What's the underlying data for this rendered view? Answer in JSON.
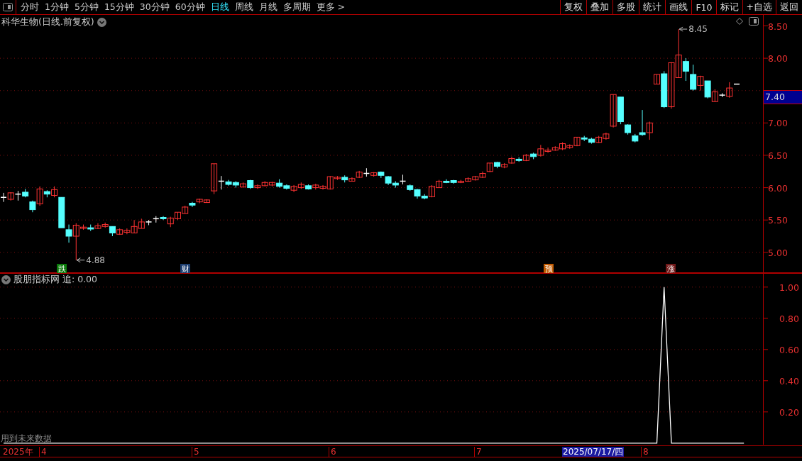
{
  "toolbar": {
    "periods": [
      {
        "label": "分时",
        "selected": false
      },
      {
        "label": "1分钟",
        "selected": false
      },
      {
        "label": "5分钟",
        "selected": false
      },
      {
        "label": "15分钟",
        "selected": false
      },
      {
        "label": "30分钟",
        "selected": false
      },
      {
        "label": "60分钟",
        "selected": false
      },
      {
        "label": "日线",
        "selected": true
      },
      {
        "label": "周线",
        "selected": false
      },
      {
        "label": "月线",
        "selected": false
      },
      {
        "label": "多周期",
        "selected": false
      },
      {
        "label": "更多 >",
        "selected": false
      }
    ],
    "actions": [
      "复权",
      "叠加",
      "多股",
      "统计",
      "画线",
      "F10",
      "标记",
      "+自选",
      "返回"
    ]
  },
  "chart": {
    "title": "科华生物(日线.前复权)",
    "current_price": "7.40",
    "low_label": "4.88",
    "high_label": "8.45",
    "chart_data": {
      "type": "candlestick",
      "ohlc": [
        [
          5.85,
          5.92,
          5.78,
          5.85
        ],
        [
          5.82,
          5.93,
          5.8,
          5.92
        ],
        [
          5.9,
          5.95,
          5.8,
          5.9
        ],
        [
          5.93,
          5.98,
          5.85,
          5.87
        ],
        [
          5.78,
          5.8,
          5.62,
          5.66
        ],
        [
          5.75,
          6.02,
          5.72,
          5.98
        ],
        [
          5.94,
          5.96,
          5.85,
          5.9
        ],
        [
          5.88,
          6.02,
          5.85,
          5.97
        ],
        [
          5.85,
          5.85,
          5.38,
          5.38
        ],
        [
          5.35,
          5.43,
          5.15,
          5.25
        ],
        [
          5.25,
          5.45,
          4.88,
          5.42
        ],
        [
          5.37,
          5.43,
          5.35,
          5.39
        ],
        [
          5.38,
          5.43,
          5.33,
          5.36
        ],
        [
          5.37,
          5.45,
          5.36,
          5.41
        ],
        [
          5.4,
          5.46,
          5.38,
          5.43
        ],
        [
          5.4,
          5.4,
          5.25,
          5.3
        ],
        [
          5.28,
          5.37,
          5.27,
          5.35
        ],
        [
          5.31,
          5.37,
          5.28,
          5.34
        ],
        [
          5.3,
          5.5,
          5.3,
          5.4
        ],
        [
          5.37,
          5.52,
          5.37,
          5.47
        ],
        [
          5.47,
          5.5,
          5.42,
          5.47
        ],
        [
          5.52,
          5.56,
          5.46,
          5.52
        ],
        [
          5.54,
          5.56,
          5.5,
          5.52
        ],
        [
          5.44,
          5.55,
          5.39,
          5.53
        ],
        [
          5.52,
          5.62,
          5.5,
          5.62
        ],
        [
          5.6,
          5.72,
          5.6,
          5.7
        ],
        [
          5.76,
          5.78,
          5.7,
          5.73
        ],
        [
          5.78,
          5.83,
          5.76,
          5.82
        ],
        [
          5.77,
          5.82,
          5.77,
          5.81
        ],
        [
          5.95,
          6.37,
          5.9,
          6.37
        ],
        [
          6.1,
          6.18,
          5.97,
          6.1
        ],
        [
          6.09,
          6.12,
          6.03,
          6.05
        ],
        [
          6.08,
          6.1,
          6.0,
          6.04
        ],
        [
          6.01,
          6.08,
          6.0,
          6.06
        ],
        [
          6.11,
          6.12,
          5.98,
          6.0
        ],
        [
          6.0,
          6.05,
          5.98,
          6.03
        ],
        [
          6.03,
          6.1,
          6.02,
          6.08
        ],
        [
          6.04,
          6.09,
          6.02,
          6.08
        ],
        [
          6.07,
          6.13,
          6.0,
          6.02
        ],
        [
          6.03,
          6.05,
          5.97,
          5.99
        ],
        [
          5.96,
          6.04,
          5.93,
          6.02
        ],
        [
          6.0,
          6.08,
          5.98,
          6.05
        ],
        [
          6.03,
          6.05,
          5.97,
          5.98
        ],
        [
          6.0,
          6.06,
          5.97,
          6.04
        ],
        [
          5.99,
          6.04,
          5.97,
          6.02
        ],
        [
          5.98,
          6.18,
          5.97,
          6.17
        ],
        [
          6.14,
          6.18,
          6.12,
          6.16
        ],
        [
          6.16,
          6.19,
          6.08,
          6.12
        ],
        [
          6.1,
          6.16,
          6.1,
          6.14
        ],
        [
          6.16,
          6.26,
          6.15,
          6.24
        ],
        [
          6.22,
          6.3,
          6.17,
          6.22
        ],
        [
          6.19,
          6.24,
          6.17,
          6.23
        ],
        [
          6.24,
          6.25,
          6.15,
          6.19
        ],
        [
          6.17,
          6.18,
          6.04,
          6.07
        ],
        [
          6.07,
          6.1,
          6.0,
          6.04
        ],
        [
          6.1,
          6.2,
          6.05,
          6.1
        ],
        [
          6.03,
          6.05,
          5.95,
          5.97
        ],
        [
          5.97,
          5.98,
          5.83,
          5.87
        ],
        [
          5.87,
          5.9,
          5.82,
          5.84
        ],
        [
          5.86,
          6.04,
          5.85,
          6.02
        ],
        [
          6.0,
          6.12,
          6.0,
          6.1
        ],
        [
          6.1,
          6.13,
          6.07,
          6.08
        ],
        [
          6.11,
          6.12,
          6.06,
          6.08
        ],
        [
          6.08,
          6.12,
          6.07,
          6.1
        ],
        [
          6.1,
          6.16,
          6.09,
          6.14
        ],
        [
          6.12,
          6.18,
          6.11,
          6.17
        ],
        [
          6.16,
          6.25,
          6.15,
          6.22
        ],
        [
          6.25,
          6.38,
          6.24,
          6.38
        ],
        [
          6.39,
          6.4,
          6.3,
          6.33
        ],
        [
          6.32,
          6.38,
          6.3,
          6.36
        ],
        [
          6.38,
          6.48,
          6.37,
          6.45
        ],
        [
          6.44,
          6.47,
          6.4,
          6.42
        ],
        [
          6.42,
          6.52,
          6.41,
          6.5
        ],
        [
          6.52,
          6.54,
          6.44,
          6.48
        ],
        [
          6.5,
          6.66,
          6.48,
          6.6
        ],
        [
          6.56,
          6.62,
          6.54,
          6.58
        ],
        [
          6.58,
          6.64,
          6.57,
          6.62
        ],
        [
          6.6,
          6.7,
          6.58,
          6.68
        ],
        [
          6.62,
          6.67,
          6.6,
          6.65
        ],
        [
          6.65,
          6.78,
          6.64,
          6.78
        ],
        [
          6.77,
          6.8,
          6.72,
          6.75
        ],
        [
          6.75,
          6.77,
          6.68,
          6.7
        ],
        [
          6.7,
          6.8,
          6.69,
          6.78
        ],
        [
          6.76,
          6.85,
          6.74,
          6.83
        ],
        [
          6.95,
          7.44,
          6.93,
          7.44
        ],
        [
          7.4,
          7.4,
          6.98,
          7.02
        ],
        [
          6.97,
          6.98,
          6.82,
          6.85
        ],
        [
          6.8,
          6.83,
          6.7,
          6.72
        ],
        [
          6.85,
          7.2,
          6.8,
          6.82
        ],
        [
          6.85,
          7.02,
          6.74,
          7.0
        ],
        [
          7.6,
          7.75,
          7.6,
          7.75
        ],
        [
          7.76,
          7.8,
          7.23,
          7.25
        ],
        [
          7.25,
          7.94,
          7.22,
          7.93
        ],
        [
          7.7,
          8.45,
          7.7,
          8.05
        ],
        [
          7.95,
          8.0,
          7.65,
          7.8
        ],
        [
          7.75,
          7.9,
          7.5,
          7.52
        ],
        [
          7.58,
          7.73,
          7.5,
          7.72
        ],
        [
          7.65,
          7.65,
          7.38,
          7.4
        ],
        [
          7.33,
          7.52,
          7.33,
          7.48
        ],
        [
          7.43,
          7.46,
          7.4,
          7.43
        ],
        [
          7.41,
          7.63,
          7.39,
          7.54
        ],
        [
          7.6,
          7.6,
          7.6,
          7.6
        ]
      ],
      "ylim": [
        4.68,
        8.67
      ],
      "grid": true,
      "yticks": [
        {
          "value": 8.5,
          "label": "8.50"
        },
        {
          "value": 8,
          "label": "8.00"
        },
        {
          "value": 7,
          "label": "7.00"
        },
        {
          "value": 6.5,
          "label": "6.50"
        },
        {
          "value": 6,
          "label": "6.00"
        },
        {
          "value": 5.5,
          "label": "5.50"
        },
        {
          "value": 5,
          "label": "5.00"
        }
      ]
    },
    "events": [
      {
        "label": "跌",
        "color": "#0a7a0a"
      },
      {
        "label": "财",
        "color": "#1d3e70"
      },
      {
        "label": "预",
        "color": "#c05a00"
      },
      {
        "label": "涨",
        "color": "#701818"
      }
    ]
  },
  "indicator": {
    "name": "股朋指标网",
    "value": "追: 0.00",
    "note": "用到未来数据",
    "chart_data": {
      "type": "line",
      "ylim": [
        -0.01,
        1.09
      ],
      "grid": true,
      "yticks": [
        {
          "value": 1,
          "label": "1.00"
        },
        {
          "value": 0.8,
          "label": "0.80"
        },
        {
          "value": 0.6,
          "label": "0.60"
        },
        {
          "value": 0.4,
          "label": "0.40"
        },
        {
          "value": 0.2,
          "label": "0.20"
        }
      ],
      "series": [
        {
          "color": "#ffffff",
          "values": [
            0,
            0,
            0,
            0,
            0,
            0,
            0,
            0,
            0,
            0,
            0,
            0,
            0,
            0,
            0,
            0,
            0,
            0,
            0,
            0,
            0,
            0,
            0,
            0,
            0,
            0,
            0,
            0,
            0,
            0,
            0,
            0,
            0,
            0,
            0,
            0,
            0,
            0,
            0,
            0,
            0,
            0,
            0,
            0,
            0,
            0,
            0,
            0,
            0,
            0,
            0,
            0,
            0,
            0,
            0,
            0,
            0,
            0,
            0,
            0,
            0,
            0,
            0,
            0,
            0,
            0,
            0,
            0,
            0,
            0,
            0,
            0,
            0,
            0,
            0,
            0,
            0,
            0,
            0,
            0,
            0,
            0,
            0,
            0,
            0,
            0,
            0,
            0,
            0,
            0,
            0,
            1,
            0,
            0,
            0,
            0,
            0,
            0,
            0,
            0,
            0,
            0,
            0
          ]
        }
      ]
    }
  },
  "date_axis": {
    "year": "2025年",
    "months": [
      "4",
      "5",
      "6",
      "7",
      "8"
    ],
    "cursor_date": "2025/07/17/四"
  }
}
